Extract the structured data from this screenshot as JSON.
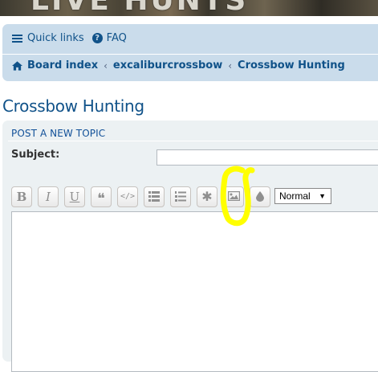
{
  "banner": {
    "text": "LIVE HUNTS"
  },
  "nav": {
    "quick_links": "Quick links",
    "faq": "FAQ",
    "breadcrumbs": [
      "Board index",
      "excaliburcrossbow",
      "Crossbow Hunting"
    ],
    "separator": "‹"
  },
  "page": {
    "title": "Crossbow Hunting"
  },
  "post": {
    "header": "POST A NEW TOPIC",
    "subject_label": "Subject:",
    "subject_value": ""
  },
  "toolbar": {
    "bold": "B",
    "italic": "I",
    "underline": "U",
    "quote": "❝",
    "code": "</>",
    "list": "list-icon",
    "ordered_list": "ordered-list-icon",
    "list_item": "✱",
    "image": "image-icon",
    "color": "color-drop-icon",
    "font_size": "Normal"
  },
  "colors": {
    "link": "#105289",
    "panel_nav": "#cadceb",
    "panel_post": "#ecf1f3",
    "highlight": "#ffff00"
  }
}
